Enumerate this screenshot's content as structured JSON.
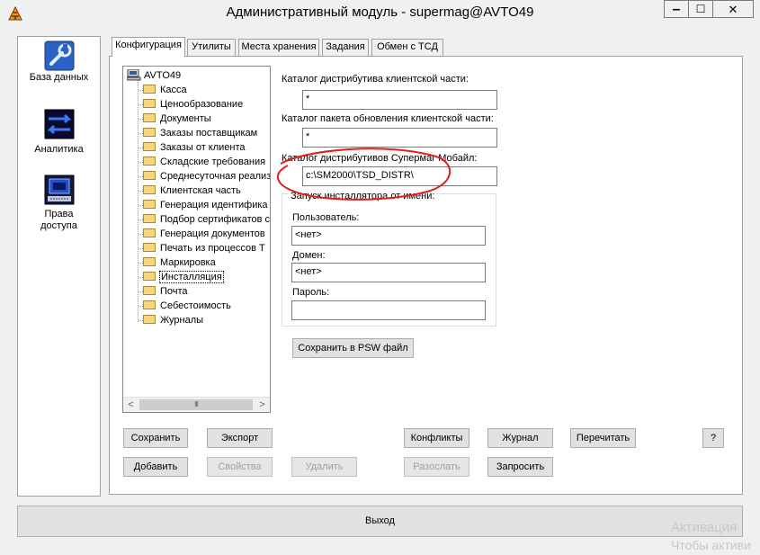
{
  "window": {
    "title": "Административный модуль - supermag@AVTO49",
    "minimize": "▁",
    "maximize": "☐",
    "close": "✕"
  },
  "sidebar": {
    "items": [
      {
        "label": "База данных",
        "icon": "database-wrench-icon"
      },
      {
        "label": "Аналитика",
        "icon": "analytics-icon"
      },
      {
        "label_line1": "Права",
        "label_line2": "доступа",
        "icon": "access-rights-icon"
      }
    ]
  },
  "tabs": [
    "Конфигурация",
    "Утилиты",
    "Места хранения",
    "Задания",
    "Обмен с ТСД"
  ],
  "tree": {
    "root": "AVTO49",
    "items": [
      "Касса",
      "Ценообразование",
      "Документы",
      "Заказы поставщикам",
      "Заказы от клиента",
      "Складские требования",
      "Среднесуточная реализ",
      "Клиентская часть",
      "Генерация идентифика",
      "Подбор сертификатов с",
      "Генерация документов",
      "Печать из процессов Т",
      "Маркировка",
      "Инсталляция",
      "Почта",
      "Себестоимость",
      "Журналы"
    ],
    "selected": "Инсталляция",
    "scroll_left": "<",
    "scroll_right": ">",
    "scroll_grip": "III"
  },
  "form": {
    "client_distr_label": "Каталог дистрибутива клиентской части:",
    "client_distr_value": "*",
    "update_pkg_label": "Каталог пакета обновления клиентской части:",
    "update_pkg_value": "*",
    "mobile_distr_label": "Каталог дистрибутивов Супермаг Мобайл:",
    "mobile_distr_value": "c:\\SM2000\\TSD_DISTR\\",
    "installer_group_label": "Запуск инсталлятора от имени:",
    "user_label": "Пользователь:",
    "user_value": "<нет>",
    "domain_label": "Домен:",
    "domain_value": "<нет>",
    "password_label": "Пароль:",
    "password_value": "",
    "save_psw_button": "Сохранить в PSW файл"
  },
  "buttons": {
    "save": "Сохранить",
    "export": "Экспорт",
    "conflicts": "Конфликты",
    "journal": "Журнал",
    "reread": "Перечитать",
    "help": "?",
    "add": "Добавить",
    "properties": "Свойства",
    "delete": "Удалить",
    "send": "Разослать",
    "request": "Запросить",
    "exit": "Выход"
  },
  "watermark": {
    "line1": "Активация",
    "line2": "Чтобы активи"
  },
  "colors": {
    "annotation_circle": "#e02020",
    "folder": "#f5d67a",
    "nav_blue": "#1a4fd0"
  }
}
